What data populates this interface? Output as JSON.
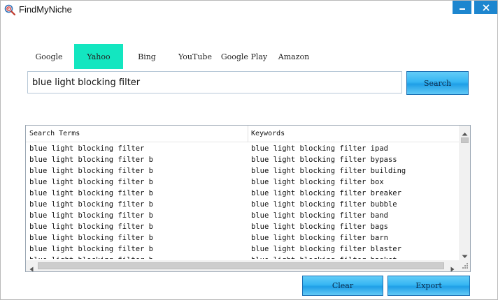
{
  "window": {
    "title": "FindMyNiche"
  },
  "icons": {
    "app": "magnifier-target-icon",
    "minimize": "minimize-icon",
    "close": "close-icon"
  },
  "colors": {
    "active_tab": "#13e6c0",
    "button": "#36b6f3",
    "title_buttons": "#1d86cf"
  },
  "tabs": [
    {
      "label": "Google",
      "active": false
    },
    {
      "label": "Yahoo",
      "active": true
    },
    {
      "label": "Bing",
      "active": false
    },
    {
      "label": "YouTube",
      "active": false
    },
    {
      "label": "Google Play",
      "active": false
    },
    {
      "label": "Amazon",
      "active": false
    }
  ],
  "search": {
    "value": "blue light blocking filter",
    "button_label": "Search"
  },
  "table": {
    "headers": [
      "Search Terms",
      "Keywords"
    ],
    "rows": [
      [
        "blue light blocking filter",
        "blue light blocking filter ipad"
      ],
      [
        "blue light blocking filter b",
        "blue light blocking filter bypass"
      ],
      [
        "blue light blocking filter b",
        "blue light blocking filter building"
      ],
      [
        "blue light blocking filter b",
        "blue light blocking filter box"
      ],
      [
        "blue light blocking filter b",
        "blue light blocking filter breaker"
      ],
      [
        "blue light blocking filter b",
        "blue light blocking filter bubble"
      ],
      [
        "blue light blocking filter b",
        "blue light blocking filter band"
      ],
      [
        "blue light blocking filter b",
        "blue light blocking filter bags"
      ],
      [
        "blue light blocking filter b",
        "blue light blocking filter barn"
      ],
      [
        "blue light blocking filter b",
        "blue light blocking filter blaster"
      ],
      [
        "blue light blocking filter b",
        "blue light blocking filter basket"
      ]
    ]
  },
  "actions": {
    "clear_label": "Clear",
    "export_label": "Export"
  }
}
